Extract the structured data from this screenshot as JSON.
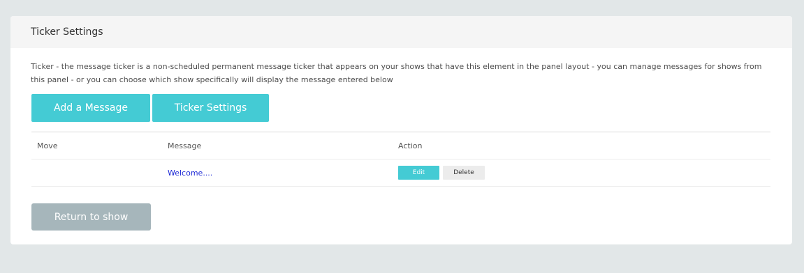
{
  "panel": {
    "title": "Ticker Settings",
    "description": "Ticker - the message ticker is a non-scheduled permanent message ticker that appears on your shows that have this element in the panel layout - you can manage messages for shows from this panel - or you can choose which show specifically will display the message entered below"
  },
  "toolbar": {
    "add_label": "Add a Message",
    "settings_label": "Ticker Settings"
  },
  "table": {
    "columns": [
      "Move",
      "Message",
      "Action"
    ],
    "rows": [
      {
        "move": "",
        "message": "Welcome....",
        "edit_label": "Edit",
        "delete_label": "Delete"
      }
    ]
  },
  "footer": {
    "return_label": "Return to show"
  },
  "colors": {
    "accent": "#44cbd4",
    "muted_button": "#a6b6bb",
    "link": "#1f2bd6",
    "background": "#e2e7e8"
  }
}
